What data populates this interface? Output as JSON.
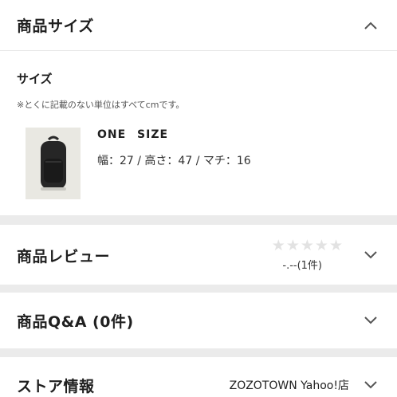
{
  "size_section": {
    "title": "商品サイズ",
    "subtitle": "サイズ",
    "note": "※とくに記載のない単位はすべてcmです。",
    "item": {
      "size_name": "ONE SIZE",
      "dimensions": "幅：27 / 高さ：47 / マチ：16"
    }
  },
  "review_section": {
    "title": "商品レビュー",
    "rating_text": "-.--(1件)",
    "star_count": 5,
    "star_color": "#e2e2e2"
  },
  "qa_section": {
    "title": "商品Q&A (0件)"
  },
  "store_section": {
    "title": "ストア情報",
    "store_name": "ZOZOTOWN Yahoo!店"
  },
  "icons": {
    "collapse": "chevron-up-icon",
    "expand": "chevron-down-icon",
    "star": "star-icon",
    "product": "backpack-image"
  }
}
